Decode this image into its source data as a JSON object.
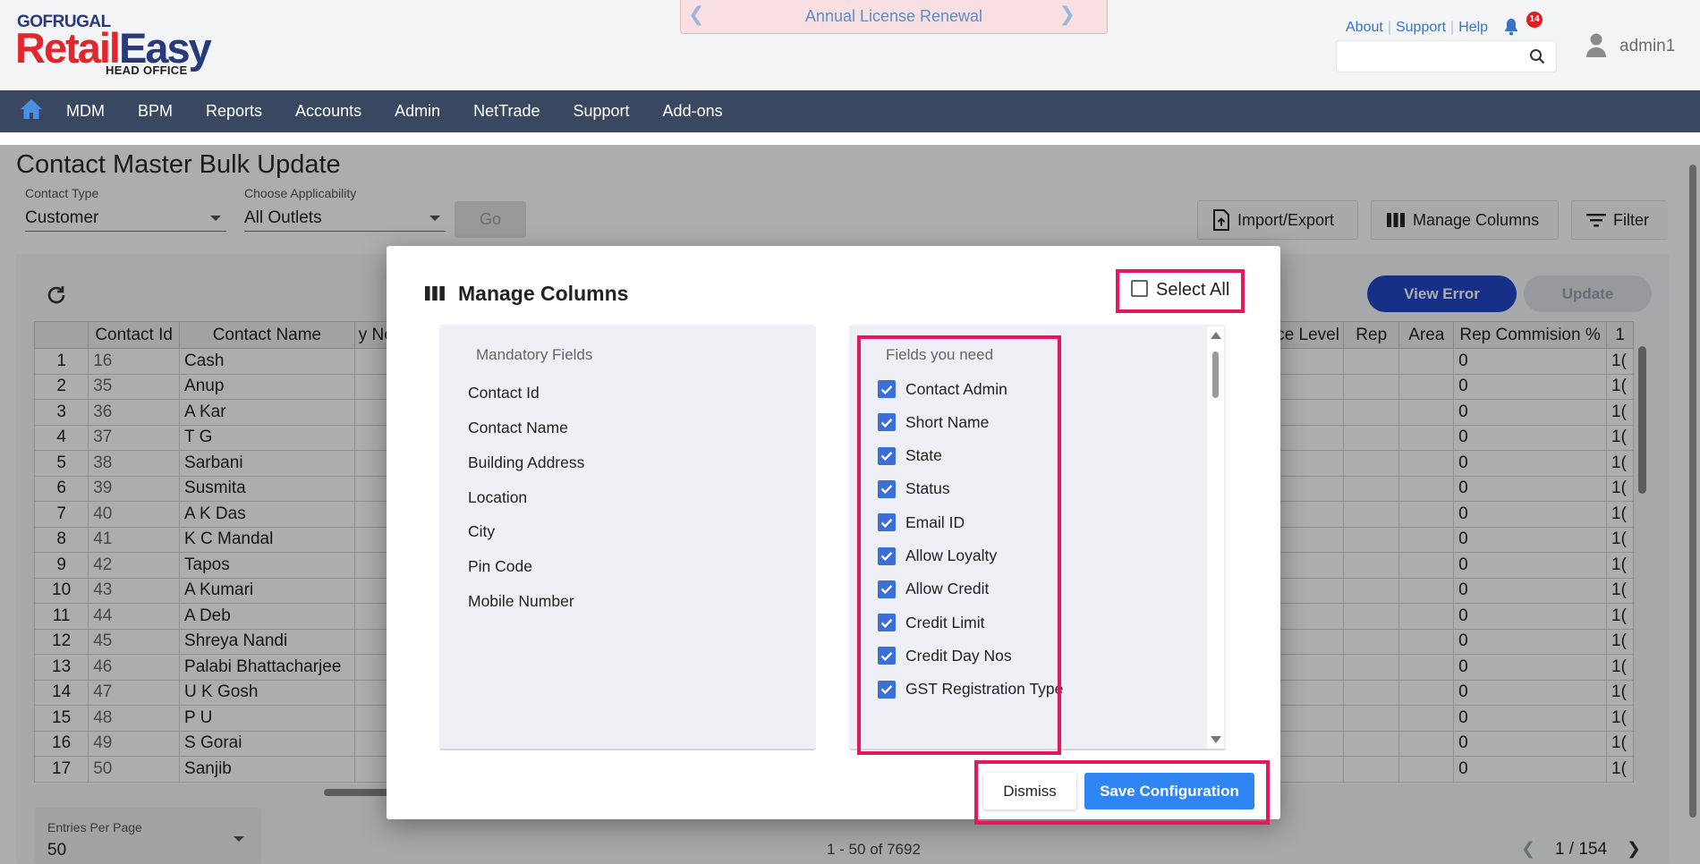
{
  "header": {
    "logo_top": "GOFRUGAL",
    "logo_main_red": "Retail",
    "logo_main_blue": "Easy",
    "logo_sub": "HEAD OFFICE",
    "renewal_text": "Annual License Renewal",
    "links": [
      "About",
      "Support",
      "Help"
    ],
    "notification_count": "14",
    "search_placeholder": "",
    "username": "admin1"
  },
  "nav": {
    "items": [
      "MDM",
      "BPM",
      "Reports",
      "Accounts",
      "Admin",
      "NetTrade",
      "Support",
      "Add-ons"
    ]
  },
  "page": {
    "title": "Contact Master Bulk Update",
    "contact_type_label": "Contact Type",
    "contact_type_value": "Customer",
    "applicability_label": "Choose Applicability",
    "applicability_value": "All Outlets",
    "go_label": "Go",
    "import_export_label": "Import/Export",
    "manage_columns_label": "Manage Columns",
    "filter_label": "Filter",
    "view_error_label": "View Error",
    "update_label": "Update"
  },
  "table": {
    "columns": [
      "",
      "Contact Id",
      "Contact Name",
      "y No",
      "ce Level",
      "Rep",
      "Area",
      "Rep Commision %",
      "1"
    ],
    "rows": [
      {
        "n": "1",
        "id": "16",
        "name": "Cash",
        "rc": "0",
        "last": "1("
      },
      {
        "n": "2",
        "id": "35",
        "name": "Anup",
        "rc": "0",
        "last": "1("
      },
      {
        "n": "3",
        "id": "36",
        "name": "A Kar",
        "rc": "0",
        "last": "1("
      },
      {
        "n": "4",
        "id": "37",
        "name": "T G",
        "rc": "0",
        "last": "1("
      },
      {
        "n": "5",
        "id": "38",
        "name": "Sarbani",
        "rc": "0",
        "last": "1("
      },
      {
        "n": "6",
        "id": "39",
        "name": "Susmita",
        "rc": "0",
        "last": "1("
      },
      {
        "n": "7",
        "id": "40",
        "name": "A K Das",
        "rc": "0",
        "last": "1("
      },
      {
        "n": "8",
        "id": "41",
        "name": "K C Mandal",
        "rc": "0",
        "last": "1("
      },
      {
        "n": "9",
        "id": "42",
        "name": "Tapos",
        "rc": "0",
        "last": "1("
      },
      {
        "n": "10",
        "id": "43",
        "name": "A Kumari",
        "rc": "0",
        "last": "1("
      },
      {
        "n": "11",
        "id": "44",
        "name": "A Deb",
        "rc": "0",
        "last": "1("
      },
      {
        "n": "12",
        "id": "45",
        "name": "Shreya Nandi",
        "rc": "0",
        "last": "1("
      },
      {
        "n": "13",
        "id": "46",
        "name": "Palabi Bhattacharjee",
        "rc": "0",
        "last": "1("
      },
      {
        "n": "14",
        "id": "47",
        "name": "U K Gosh",
        "rc": "0",
        "last": "1("
      },
      {
        "n": "15",
        "id": "48",
        "name": "P U",
        "rc": "0",
        "last": "1("
      },
      {
        "n": "16",
        "id": "49",
        "name": "S Gorai",
        "rc": "0",
        "last": "1("
      },
      {
        "n": "17",
        "id": "50",
        "name": "Sanjib",
        "rc": "0",
        "last": "1("
      }
    ]
  },
  "footer": {
    "entries_label": "Entries Per Page",
    "entries_value": "50",
    "range_text": "1 - 50 of 7692",
    "page_text": "1 / 154"
  },
  "modal": {
    "title": "Manage Columns",
    "select_all_label": "Select All",
    "mandatory_heading": "Mandatory Fields",
    "mandatory_fields": [
      "Contact Id",
      "Contact Name",
      "Building Address",
      "Location",
      "City",
      "Pin Code",
      "Mobile Number"
    ],
    "needed_heading": "Fields you need",
    "needed_fields": [
      "Contact Admin",
      "Short Name",
      "State",
      "Status",
      "Email ID",
      "Allow Loyalty",
      "Allow Credit",
      "Credit Limit",
      "Credit Day Nos",
      "GST Registration Type"
    ],
    "dismiss_label": "Dismiss",
    "save_label": "Save Configuration"
  },
  "colors": {
    "accent": "#2f86f2",
    "navbar": "#394860",
    "highlight": "#e8175d",
    "brand_red": "#e3262b",
    "brand_blue": "#283a7a"
  }
}
